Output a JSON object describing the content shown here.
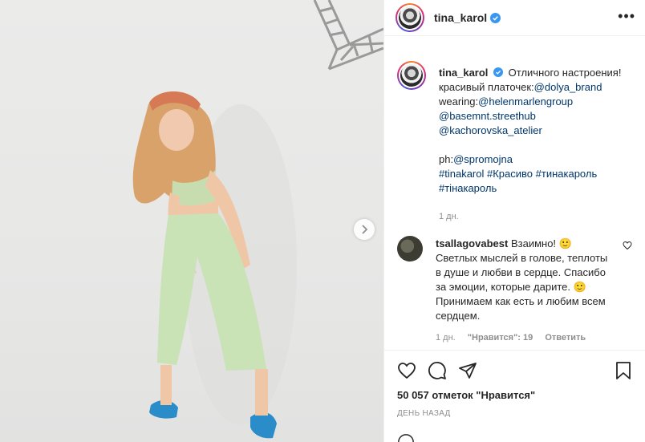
{
  "post": {
    "username": "tina_karol",
    "more_label": "•••",
    "next_label": "›"
  },
  "caption": {
    "username": "tina_karol",
    "line1": "Отличного настроения!",
    "line2_prefix": "красивый платочек:",
    "mention_dolya": "@dolya_brand",
    "line3_prefix": "wearing:",
    "mention_helen": "@helenmarlengroup",
    "mention_basemnt": "@basemnt.streethub",
    "mention_kachor": "@kachorovska_atelier",
    "ph_prefix": "ph:",
    "mention_sp": "@spromojna",
    "tag1": "#tinakarol",
    "tag2": "#Красиво",
    "tag3": "#тинакароль",
    "tag4": "#тінакароль",
    "time": "1 дн."
  },
  "comment": {
    "username": "tsallagovabest",
    "text": "Взаимно! 🙂 Светлых мыслей в голове, теплоты в душе и любви в сердце. Спасибо за эмоции, которые дарите. 🙂 Принимаем как есть и любим всем сердцем.",
    "time": "1 дн.",
    "likes": "\"Нравится\": 19",
    "reply": "Ответить"
  },
  "footer": {
    "likes": "50 057 отметок \"Нравится\"",
    "date": "День назад"
  },
  "colors": {
    "verified": "#3897f0",
    "link": "#00376b",
    "meta": "#8e8e8e"
  },
  "icons": [
    "heart-icon",
    "comment-icon",
    "share-icon",
    "bookmark-icon",
    "more-icon",
    "verified-icon",
    "chevron-right-icon"
  ]
}
